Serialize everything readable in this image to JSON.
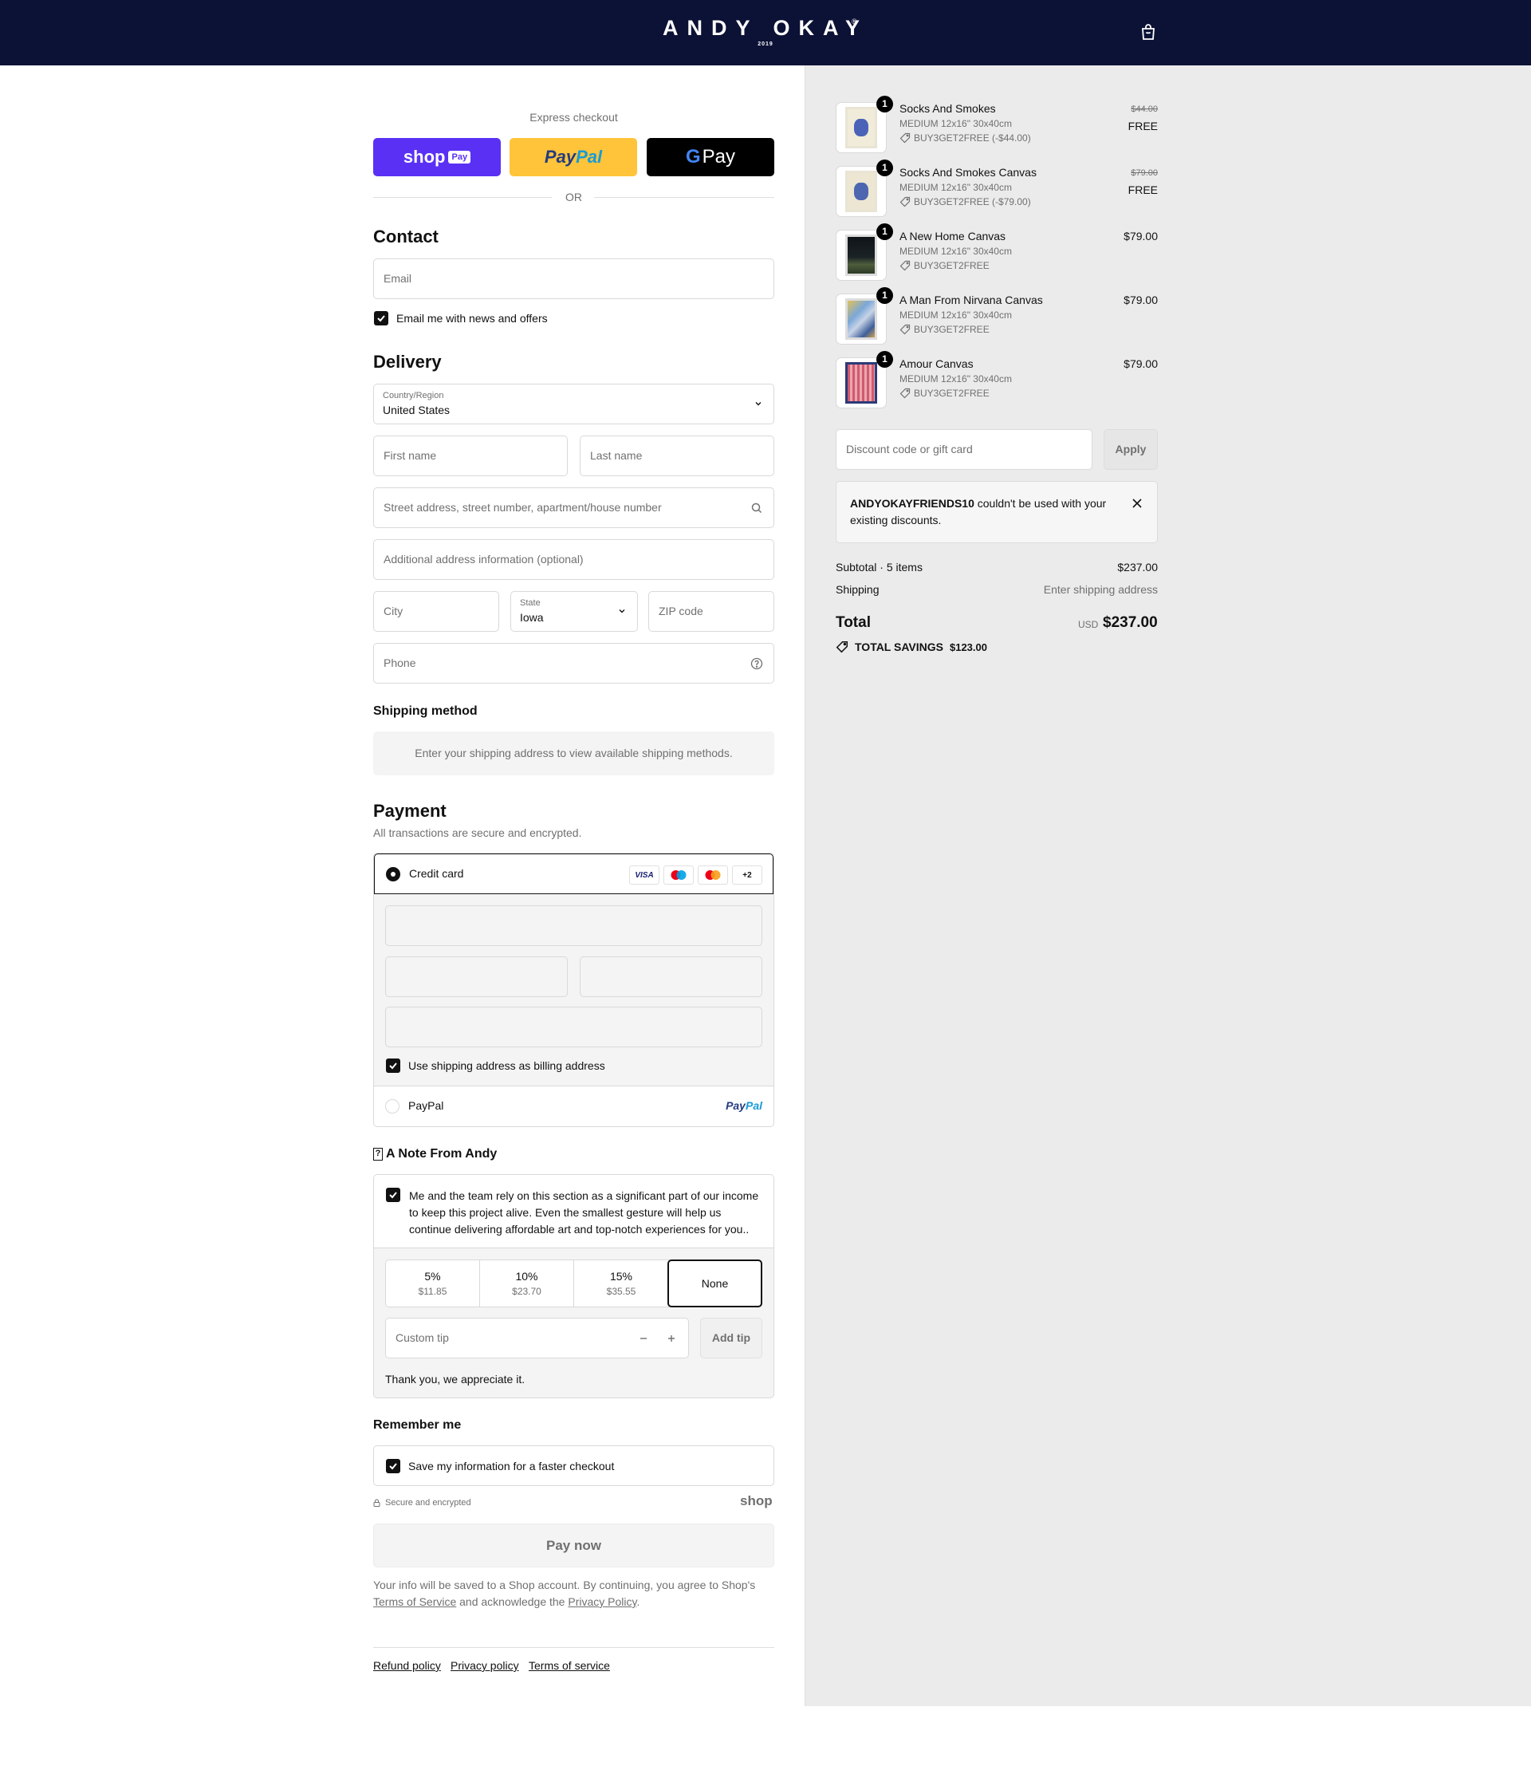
{
  "header": {
    "logo": "ANDY OKAY",
    "logo_reg": "®",
    "logo_year": "2019"
  },
  "express": {
    "title": "Express checkout",
    "shop_pay": {
      "shop": "shop",
      "pay": "Pay"
    },
    "paypal": {
      "pay": "Pay",
      "pal": "Pal"
    },
    "gpay": {
      "g": "G",
      "pay": "Pay"
    },
    "or": "OR"
  },
  "contact": {
    "title": "Contact",
    "email_placeholder": "Email",
    "newsletter_label": "Email me with news and offers"
  },
  "delivery": {
    "title": "Delivery",
    "country_label": "Country/Region",
    "country_value": "United States",
    "first_name": "First name",
    "last_name": "Last name",
    "address": "Street address, street number, apartment/house number",
    "address2": "Additional address information (optional)",
    "city": "City",
    "state_label": "State",
    "state_value": "Iowa",
    "zip": "ZIP code",
    "phone": "Phone"
  },
  "shipping_method": {
    "title": "Shipping method",
    "info": "Enter your shipping address to view available shipping methods."
  },
  "payment": {
    "title": "Payment",
    "subtitle": "All transactions are secure and encrypted.",
    "credit_card_label": "Credit card",
    "cards": [
      "VISA",
      "+2"
    ],
    "billing_label": "Use shipping address as billing address",
    "paypal_label": "PayPal",
    "paypal_logo": {
      "pay": "Pay",
      "pal": "Pal"
    }
  },
  "tip": {
    "title": "A Note From Andy",
    "glyph": "?",
    "text": "Me and the team rely on this section as a significant part of our income to keep this project alive. Even the smallest gesture will help us continue delivering affordable art and top-notch experiences for you..",
    "options": [
      {
        "percent": "5%",
        "amount": "$11.85"
      },
      {
        "percent": "10%",
        "amount": "$23.70"
      },
      {
        "percent": "15%",
        "amount": "$35.55"
      }
    ],
    "none_label": "None",
    "custom_placeholder": "Custom tip",
    "add_label": "Add tip",
    "thanks": "Thank you, we appreciate it."
  },
  "remember": {
    "title": "Remember me",
    "save_label": "Save my information for a faster checkout",
    "secure": "Secure and encrypted",
    "shop_logo": "shop"
  },
  "pay_now": "Pay now",
  "legal": {
    "text1": "Your info will be saved to a Shop account. By continuing, you agree to Shop's",
    "terms": "Terms of Service",
    "text2": "and acknowledge the",
    "privacy": "Privacy Policy",
    "text3": "."
  },
  "footer": {
    "refund": "Refund policy",
    "privacy": "Privacy policy",
    "terms": "Terms of service"
  },
  "order": {
    "items": [
      {
        "name": "Socks And Smokes",
        "variant": "MEDIUM 12x16\" 30x40cm",
        "code": "BUY3GET2FREE (-$44.00)",
        "old_price": "$44.00",
        "price": "FREE",
        "qty": "1"
      },
      {
        "name": "Socks And Smokes Canvas",
        "variant": "MEDIUM 12x16\" 30x40cm",
        "code": "BUY3GET2FREE (-$79.00)",
        "old_price": "$79.00",
        "price": "FREE",
        "qty": "1"
      },
      {
        "name": "A New Home Canvas",
        "variant": "MEDIUM 12x16\" 30x40cm",
        "code": "BUY3GET2FREE",
        "price": "$79.00",
        "qty": "1"
      },
      {
        "name": "A Man From Nirvana Canvas",
        "variant": "MEDIUM 12x16\" 30x40cm",
        "code": "BUY3GET2FREE",
        "price": "$79.00",
        "qty": "1"
      },
      {
        "name": "Amour Canvas",
        "variant": "MEDIUM 12x16\" 30x40cm",
        "code": "BUY3GET2FREE",
        "price": "$79.00",
        "qty": "1"
      }
    ],
    "discount_placeholder": "Discount code or gift card",
    "apply": "Apply",
    "warning_code": "ANDYOKAYFRIENDS10",
    "warning_text": " couldn't be used with your existing discounts.",
    "subtotal_label": "Subtotal · 5 items",
    "subtotal": "$237.00",
    "shipping_label": "Shipping",
    "shipping": "Enter shipping address",
    "total_label": "Total",
    "currency": "USD",
    "total": "$237.00",
    "savings_label": "TOTAL SAVINGS",
    "savings": "$123.00"
  },
  "colors": {
    "header_bg": "#0c1235",
    "shop_pay": "#5a31f4",
    "paypal": "#ffc439",
    "summary_bg": "#ebebeb"
  }
}
